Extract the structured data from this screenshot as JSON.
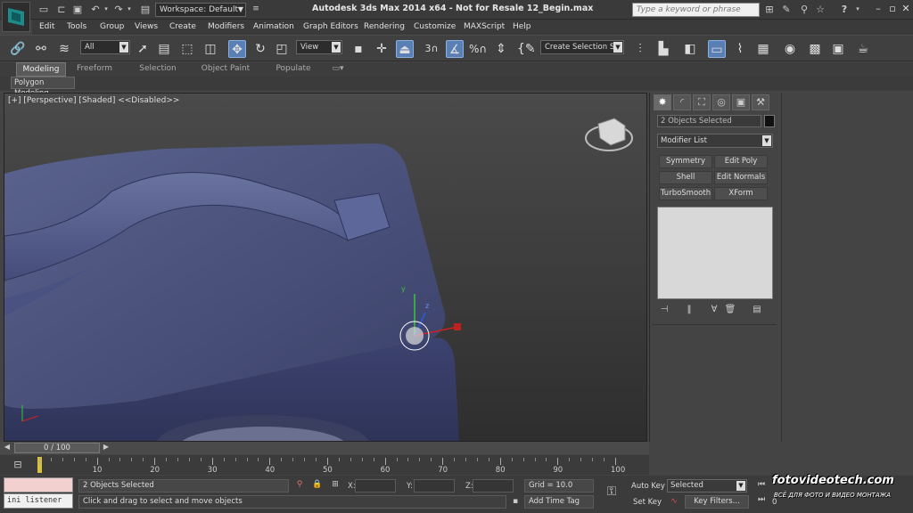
{
  "title_bar": {
    "workspace": "Workspace: Default",
    "app_title": "Autodesk 3ds Max  2014 x64   - Not for Resale    12_Begin.max",
    "search_placeholder": "Type a keyword or phrase",
    "help": "?"
  },
  "menu": [
    "Edit",
    "Tools",
    "Group",
    "Views",
    "Create",
    "Modifiers",
    "Animation",
    "Graph Editors",
    "Rendering",
    "Customize",
    "MAXScript",
    "Help"
  ],
  "main_toolbar": {
    "filter": "All",
    "ref_coord": "View",
    "snap_label": "3",
    "named_selection": "Create Selection Se"
  },
  "ribbon": {
    "tabs": [
      "Modeling",
      "Freeform",
      "Selection",
      "Object Paint",
      "Populate"
    ],
    "active_tab": "Modeling",
    "sub_tab": "Polygon Modeling"
  },
  "viewport": {
    "label": "[+] [Perspective] [Shaded]  <<Disabled>>",
    "gizmo_labels": {
      "y": "y",
      "z": "z"
    }
  },
  "command_panel": {
    "object_name": "2 Objects Selected",
    "modifier_list": "Modifier List",
    "modifier_buttons": [
      "Symmetry",
      "Edit Poly",
      "Shell",
      "Edit Normals",
      "TurboSmooth",
      "XForm"
    ]
  },
  "timeline": {
    "slider_label": "0 / 100",
    "ticks": [
      "10",
      "20",
      "30",
      "40",
      "50",
      "60",
      "70",
      "80",
      "90",
      "100"
    ]
  },
  "status_bar": {
    "listener_text": "ini listener",
    "selection_info": "2 Objects Selected",
    "prompt": "Click and drag to select and move objects",
    "x_label": "X:",
    "y_label": "Y:",
    "z_label": "Z:",
    "grid": "Grid = 10.0",
    "add_time_tag": "Add Time Tag",
    "auto_key": "Auto Key",
    "set_key": "Set Key",
    "selected": "Selected",
    "key_filters": "Key Filters...",
    "frame_value": "0"
  },
  "watermark": {
    "main": "fotovideotech.com",
    "sub": "ВСЁ ДЛЯ ФОТО И ВИДЕО МОНТАЖА"
  }
}
